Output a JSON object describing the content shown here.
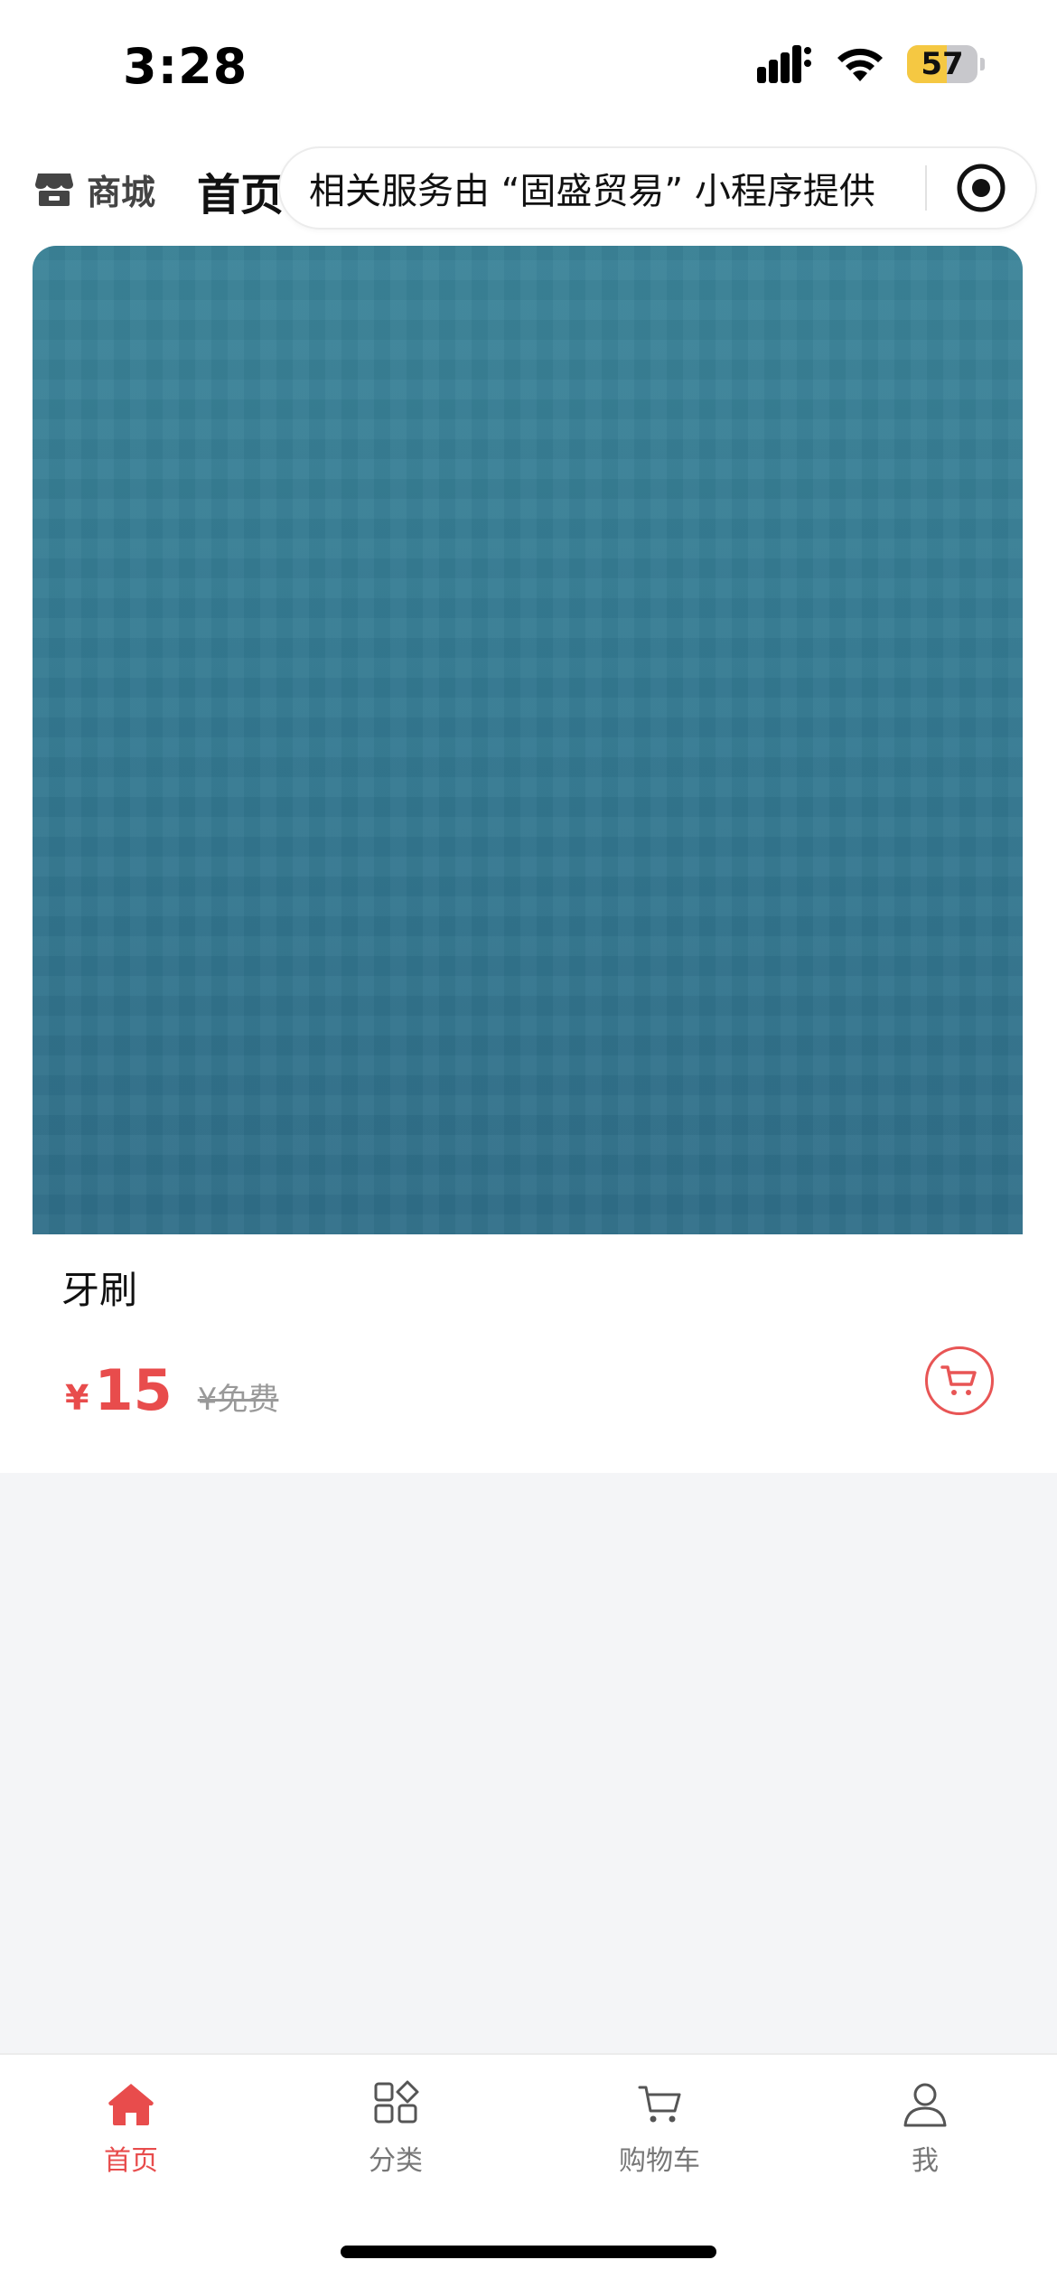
{
  "status_bar": {
    "time": "3:28",
    "battery_level": "57",
    "signal_icon": "cellular-signal-icon",
    "wifi_icon": "wifi-icon"
  },
  "nav": {
    "shop_label": "商城",
    "title": "首页",
    "service_text": "相关服务由 “固盛贸易” 小程序提供",
    "close_icon": "record-icon"
  },
  "product": {
    "name": "牙刷",
    "price_symbol": "¥",
    "price": "15",
    "original_price": "¥免费",
    "image_color": "#357d95",
    "cart_icon": "cart-icon"
  },
  "tabs": [
    {
      "label": "首页",
      "icon": "home-icon",
      "active": true
    },
    {
      "label": "分类",
      "icon": "category-icon",
      "active": false
    },
    {
      "label": "购物车",
      "icon": "cart-icon",
      "active": false
    },
    {
      "label": "我",
      "icon": "user-icon",
      "active": false
    }
  ],
  "colors": {
    "accent": "#e84c4c",
    "background": "#f4f5f7"
  }
}
